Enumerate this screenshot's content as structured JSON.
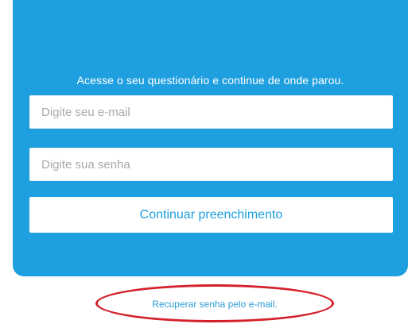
{
  "login": {
    "title": "Acesse o seu questionário e continue de onde parou.",
    "email_placeholder": "Digite seu e-mail",
    "password_placeholder": "Digite sua senha",
    "continue_label": "Continuar preenchimento"
  },
  "recover": {
    "link_label": "Recuperar senha pelo e-mail."
  },
  "colors": {
    "card_background": "#1e9fe0",
    "button_text": "#1e9fe0",
    "highlight": "#d4202a"
  }
}
